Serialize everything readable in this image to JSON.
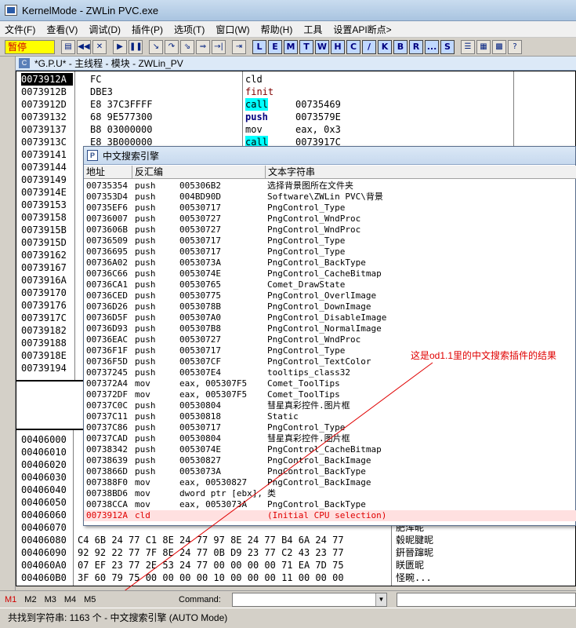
{
  "window": {
    "title": "KernelMode - ZWLin PVC.exe"
  },
  "menu": [
    "文件(F)",
    "查看(V)",
    "调试(D)",
    "插件(P)",
    "选项(T)",
    "窗口(W)",
    "帮助(H)",
    "工具",
    "设置API断点>"
  ],
  "toolbar": {
    "state": "暂停",
    "letters": [
      "L",
      "E",
      "M",
      "T",
      "W",
      "H",
      "C",
      "/",
      "K",
      "B",
      "R",
      "...",
      "S"
    ]
  },
  "mdi": {
    "title": "*G.P.U* - 主线程 - 模块 - ZWLin_PV"
  },
  "cpu": {
    "rows": [
      {
        "addr": "0073912A",
        "hex": "FC",
        "mn": "cld",
        "op": ""
      },
      {
        "addr": "0073912B",
        "hex": "DBE3",
        "mn": "finit",
        "op": ""
      },
      {
        "addr": "0073912D",
        "hex": "E8 37C3FFFF",
        "mn": "call",
        "op": "00735469"
      },
      {
        "addr": "00739132",
        "hex": "68 9E577300",
        "mn": "push",
        "op": "0073579E"
      },
      {
        "addr": "00739137",
        "hex": "B8 03000000",
        "mn": "mov",
        "op": "eax, 0x3"
      },
      {
        "addr": "0073913C",
        "hex": "E8 3B000000",
        "mn": "call",
        "op": "0073917C"
      },
      {
        "addr": "00739141",
        "hex": "",
        "mn": "",
        "op": ""
      },
      {
        "addr": "00739144",
        "hex": "",
        "mn": "",
        "op": ""
      },
      {
        "addr": "00739149",
        "hex": "",
        "mn": "",
        "op": ""
      },
      {
        "addr": "0073914E",
        "hex": "",
        "mn": "",
        "op": ""
      },
      {
        "addr": "00739153",
        "hex": "",
        "mn": "",
        "op": ""
      },
      {
        "addr": "00739158",
        "hex": "",
        "mn": "",
        "op": ""
      },
      {
        "addr": "0073915B",
        "hex": "",
        "mn": "",
        "op": ""
      },
      {
        "addr": "0073915D",
        "hex": "",
        "mn": "",
        "op": ""
      },
      {
        "addr": "00739162",
        "hex": "",
        "mn": "",
        "op": ""
      },
      {
        "addr": "00739167",
        "hex": "",
        "mn": "",
        "op": ""
      },
      {
        "addr": "0073916A",
        "hex": "",
        "mn": "",
        "op": ""
      },
      {
        "addr": "00739170",
        "hex": "",
        "mn": "",
        "op": ""
      },
      {
        "addr": "00739176",
        "hex": "",
        "mn": "",
        "op": ""
      },
      {
        "addr": "0073917C",
        "hex": "",
        "mn": "",
        "op": ""
      },
      {
        "addr": "00739182",
        "hex": "",
        "mn": "",
        "op": ""
      },
      {
        "addr": "00739188",
        "hex": "",
        "mn": "",
        "op": ""
      },
      {
        "addr": "0073918E",
        "hex": "",
        "mn": "",
        "op": ""
      },
      {
        "addr": "00739194",
        "hex": "",
        "mn": "",
        "op": ""
      }
    ]
  },
  "dump": {
    "rows": [
      {
        "addr": "00406000",
        "hex": "",
        "ascii": ""
      },
      {
        "addr": "00406010",
        "hex": "",
        "ascii": ""
      },
      {
        "addr": "00406020",
        "hex": "",
        "ascii": ""
      },
      {
        "addr": "00406030",
        "hex": "",
        "ascii": ""
      },
      {
        "addr": "00406040",
        "hex": "",
        "ascii": ""
      },
      {
        "addr": "00406050",
        "hex": "",
        "ascii": ""
      },
      {
        "addr": "00406060",
        "hex": "",
        "ascii": ""
      },
      {
        "addr": "00406070",
        "hex": "",
        "ascii": "肥浑昵"
      },
      {
        "addr": "00406080",
        "hex": "C4 6B 24 77 C1 8E 24 77 97 8E 24 77 B4 6A 24 77",
        "ascii": "毂昵腱昵"
      },
      {
        "addr": "00406090",
        "hex": "92 92 22 77 7F 8E 24 77 0B D9 23 77 C2 43 23 77",
        "ascii": "銒晉蹿昵"
      },
      {
        "addr": "004060A0",
        "hex": "07 EF 23 77 2E 53 24 77 00 00 00 00 71 EA 7D 75",
        "ascii": "眹匮昵"
      },
      {
        "addr": "004060B0",
        "hex": "3F 60 79 75 00 00 00 00 10 00 00 00 11 00 00 00",
        "ascii": "怪畹..."
      }
    ]
  },
  "search": {
    "title": "中文搜索引擎",
    "headers": [
      "地址",
      "反汇编",
      "文本字符串"
    ],
    "rows": [
      {
        "addr": "00735354",
        "mn": "push",
        "op": "005306B2",
        "text": "选择背景图所在文件夹"
      },
      {
        "addr": "007353D4",
        "mn": "push",
        "op": "004BD90D",
        "text": "Software\\ZWLin PVC\\背景"
      },
      {
        "addr": "00735EF6",
        "mn": "push",
        "op": "00530717",
        "text": "PngControl_Type"
      },
      {
        "addr": "00736007",
        "mn": "push",
        "op": "00530727",
        "text": "PngControl_WndProc"
      },
      {
        "addr": "0073606B",
        "mn": "push",
        "op": "00530727",
        "text": "PngControl_WndProc"
      },
      {
        "addr": "00736509",
        "mn": "push",
        "op": "00530717",
        "text": "PngControl_Type"
      },
      {
        "addr": "00736695",
        "mn": "push",
        "op": "00530717",
        "text": "PngControl_Type"
      },
      {
        "addr": "00736A02",
        "mn": "push",
        "op": "0053073A",
        "text": "PngControl_BackType"
      },
      {
        "addr": "00736C66",
        "mn": "push",
        "op": "0053074E",
        "text": "PngControl_CacheBitmap"
      },
      {
        "addr": "00736CA1",
        "mn": "push",
        "op": "00530765",
        "text": "Comet_DrawState"
      },
      {
        "addr": "00736CED",
        "mn": "push",
        "op": "00530775",
        "text": "PngControl_OverlImage"
      },
      {
        "addr": "00736D26",
        "mn": "push",
        "op": "0053078B",
        "text": "PngControl_DownImage"
      },
      {
        "addr": "00736D5F",
        "mn": "push",
        "op": "005307A0",
        "text": "PngControl_DisableImage"
      },
      {
        "addr": "00736D93",
        "mn": "push",
        "op": "005307B8",
        "text": "PngControl_NormalImage"
      },
      {
        "addr": "00736EAC",
        "mn": "push",
        "op": "00530727",
        "text": "PngControl_WndProc"
      },
      {
        "addr": "00736F1F",
        "mn": "push",
        "op": "00530717",
        "text": "PngControl_Type"
      },
      {
        "addr": "00736F5D",
        "mn": "push",
        "op": "005307CF",
        "text": "PngControl_TextColor"
      },
      {
        "addr": "00737245",
        "mn": "push",
        "op": "005307E4",
        "text": "tooltips_class32"
      },
      {
        "addr": "007372A4",
        "mn": "mov",
        "op": "eax, 005307F5",
        "text": "Comet_ToolTips"
      },
      {
        "addr": "007372DF",
        "mn": "mov",
        "op": "eax, 005307F5",
        "text": "Comet_ToolTips"
      },
      {
        "addr": "00737C0C",
        "mn": "push",
        "op": "00530804",
        "text": "彗星真彩控件.图片框"
      },
      {
        "addr": "00737C11",
        "mn": "push",
        "op": "00530818",
        "text": "Static"
      },
      {
        "addr": "00737C86",
        "mn": "push",
        "op": "00530717",
        "text": "PngControl_Type"
      },
      {
        "addr": "00737CAD",
        "mn": "push",
        "op": "00530804",
        "text": "彗星真彩控件.图片框"
      },
      {
        "addr": "00738342",
        "mn": "push",
        "op": "0053074E",
        "text": "PngControl_CacheBitmap"
      },
      {
        "addr": "00738639",
        "mn": "push",
        "op": "00530827",
        "text": "PngControl_BackImage"
      },
      {
        "addr": "0073866D",
        "mn": "push",
        "op": "0053073A",
        "text": "PngControl_BackType"
      },
      {
        "addr": "007388F0",
        "mn": "mov",
        "op": "eax, 00530827",
        "text": "PngControl_BackImage"
      },
      {
        "addr": "00738BD6",
        "mn": "mov",
        "op": "dword ptr [ebx],",
        "text": "类"
      },
      {
        "addr": "00738CCA",
        "mn": "mov",
        "op": "eax, 0053073A",
        "text": "PngControl_BackType"
      },
      {
        "addr": "0073912A",
        "mn": "cld",
        "op": "",
        "text": "(Initial CPU selection)"
      }
    ]
  },
  "annotation": "这是od1.1里的中文搜索插件的结果",
  "bottom": {
    "tabs": [
      "M1",
      "M2",
      "M3",
      "M4",
      "M5"
    ],
    "command_label": "Command:"
  },
  "status": "共找到字符串: 1163 个 - 中文搜索引擎 (AUTO Mode)"
}
